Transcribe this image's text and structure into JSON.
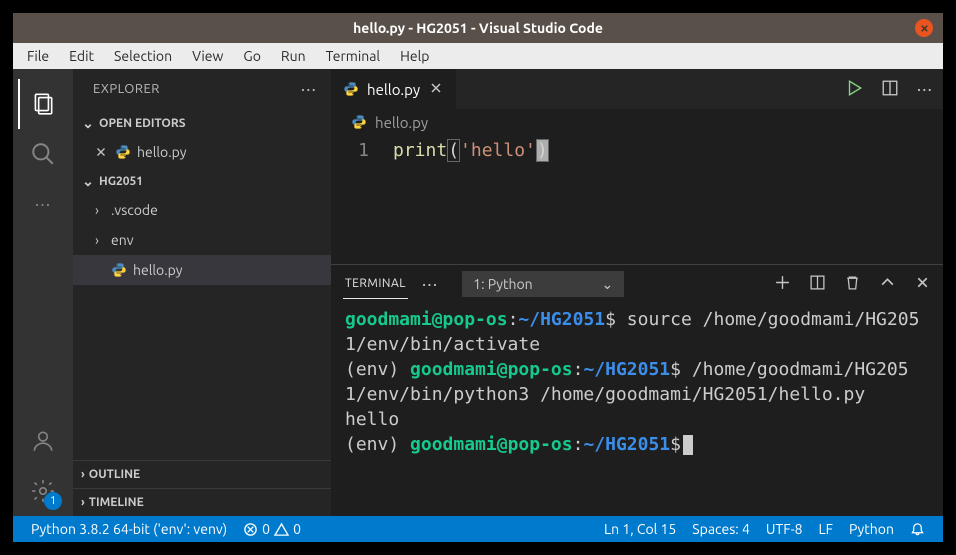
{
  "window": {
    "title": "hello.py - HG2051 - Visual Studio Code"
  },
  "menubar": [
    "File",
    "Edit",
    "Selection",
    "View",
    "Go",
    "Run",
    "Terminal",
    "Help"
  ],
  "sidebar": {
    "title": "EXPLORER",
    "open_editors_label": "OPEN EDITORS",
    "workspace_label": "HG2051",
    "open_editor_file": "hello.py",
    "folders": [
      {
        "name": ".vscode"
      },
      {
        "name": "env"
      }
    ],
    "files": [
      {
        "name": "hello.py"
      }
    ],
    "outline_label": "OUTLINE",
    "timeline_label": "TIMELINE"
  },
  "activity": {
    "gear_badge": "1"
  },
  "editor": {
    "tab_file": "hello.py",
    "breadcrumb": "hello.py",
    "line_number": "1",
    "code": {
      "fn": "print",
      "open": "(",
      "str": "'hello'",
      "close": ")"
    }
  },
  "panel": {
    "tab": "TERMINAL",
    "select": "1: Python"
  },
  "terminal": {
    "user": "goodmami",
    "host": "pop-os",
    "path": "~/HG2051",
    "line1_cmd": " source /home/goodmami/HG2051/env/bin/activate",
    "env_prefix": "(env) ",
    "line2_cmd": " /home/goodmami/HG2051/env/bin/python3 /home/goodmami/HG2051/hello.py",
    "output": "hello"
  },
  "statusbar": {
    "python": "Python 3.8.2 64-bit ('env': venv)",
    "errors": "0",
    "warnings": "0",
    "cursor": "Ln 1, Col 15",
    "spaces": "Spaces: 4",
    "encoding": "UTF-8",
    "eol": "LF",
    "lang": "Python"
  }
}
